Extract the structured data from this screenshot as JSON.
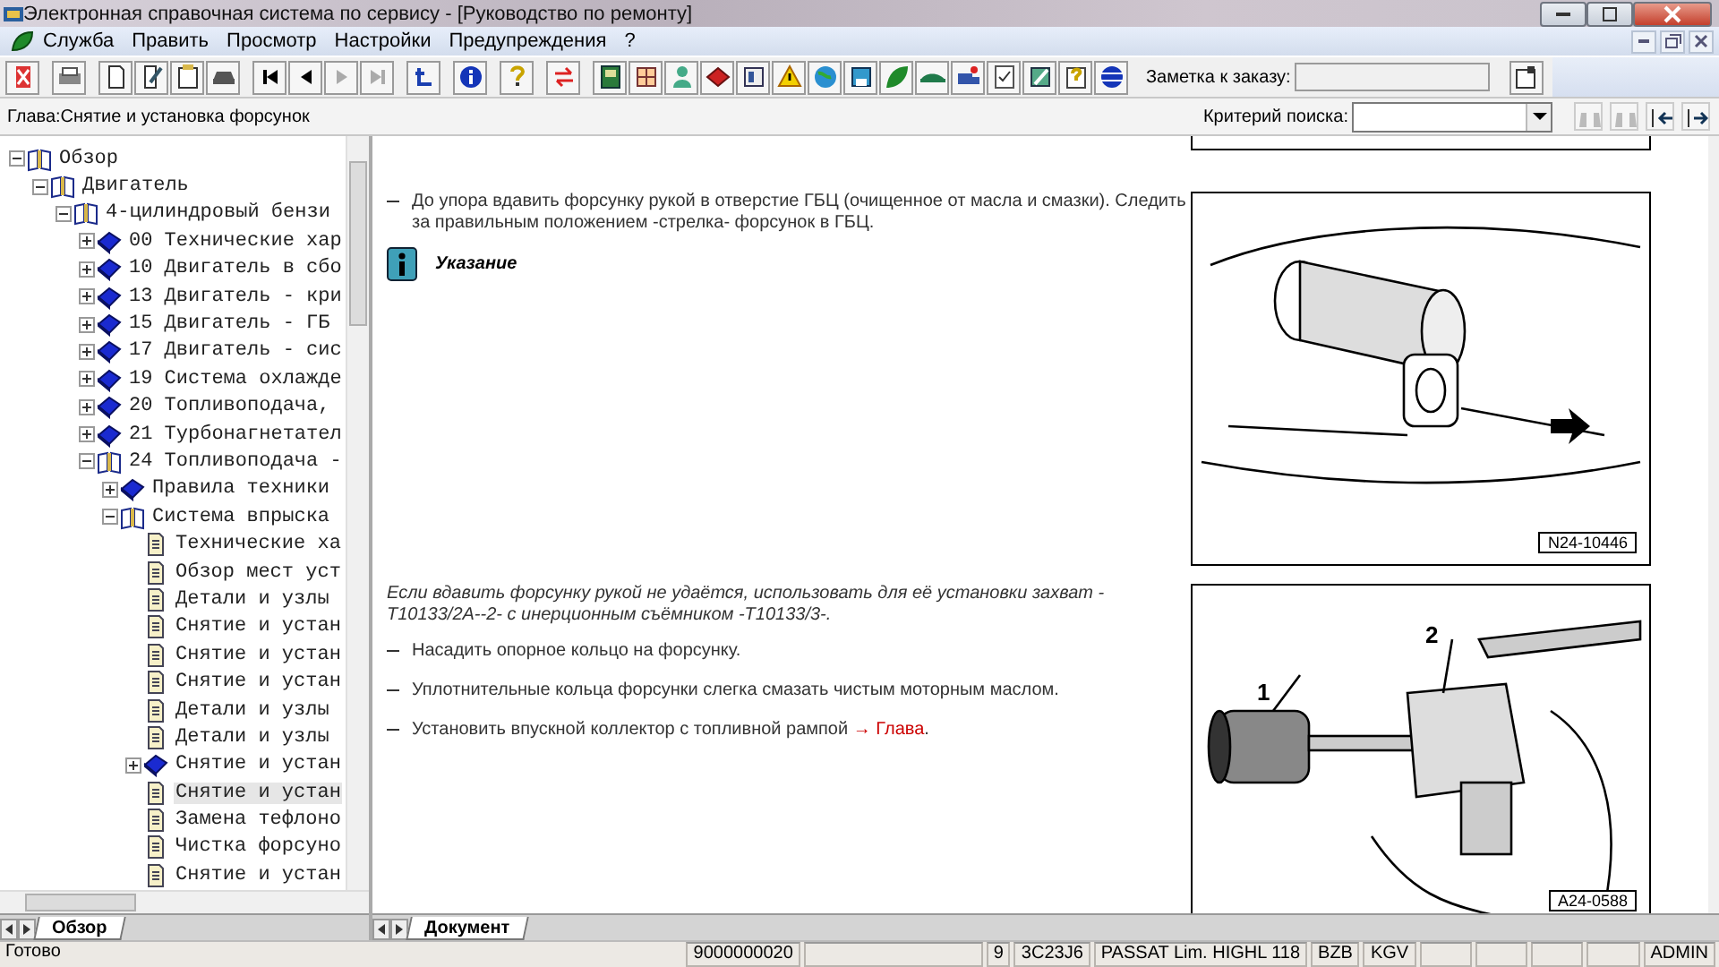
{
  "window": {
    "title": "Электронная справочная система по сервису - [Руководство по ремонту]"
  },
  "menu": [
    "Служба",
    "Править",
    "Просмотр",
    "Настройки",
    "Предупреждения",
    "?"
  ],
  "toolbar": {
    "note_label": "Заметка к заказу:"
  },
  "chapter_bar": {
    "chapter": "Глава:Снятие и установка форсунок",
    "search_label": "Критерий поиска:"
  },
  "tree": [
    {
      "kind": "chapter",
      "label": "Обзор",
      "expanded": true,
      "selected": false,
      "children": [
        {
          "kind": "chapter",
          "label": "Двигатель",
          "expanded": true,
          "selected": false,
          "children": [
            {
              "kind": "chapter",
              "label": "4-цилиндровый бензи",
              "expanded": true,
              "selected": false,
              "children": [
                {
                  "kind": "chapter",
                  "label": "00 Технические хар",
                  "expanded": false,
                  "selected": false
                },
                {
                  "kind": "chapter",
                  "label": "10 Двигатель в сбо",
                  "expanded": false,
                  "selected": false
                },
                {
                  "kind": "chapter",
                  "label": "13 Двигатель - кри",
                  "expanded": false,
                  "selected": false
                },
                {
                  "kind": "chapter",
                  "label": "15 Двигатель - ГБ",
                  "expanded": false,
                  "selected": false
                },
                {
                  "kind": "chapter",
                  "label": "17 Двигатель - сис",
                  "expanded": false,
                  "selected": false
                },
                {
                  "kind": "chapter",
                  "label": "19 Система охлажде",
                  "expanded": false,
                  "selected": false
                },
                {
                  "kind": "chapter",
                  "label": "20 Топливоподача,",
                  "expanded": false,
                  "selected": false
                },
                {
                  "kind": "chapter",
                  "label": "21 Турбонагнетател",
                  "expanded": false,
                  "selected": false
                },
                {
                  "kind": "chapter",
                  "label": "24 Топливоподача -",
                  "expanded": true,
                  "selected": false,
                  "children": [
                    {
                      "kind": "chapter",
                      "label": "Правила техники",
                      "expanded": false,
                      "selected": false
                    },
                    {
                      "kind": "chapter",
                      "label": "Система впрыска",
                      "expanded": true,
                      "selected": false,
                      "children": [
                        {
                          "kind": "page",
                          "label": "Технические ха",
                          "selected": false
                        },
                        {
                          "kind": "page",
                          "label": "Обзор мест уст",
                          "selected": false
                        },
                        {
                          "kind": "page",
                          "label": "Детали и узлы",
                          "selected": false
                        },
                        {
                          "kind": "page",
                          "label": "Снятие и устан",
                          "selected": false
                        },
                        {
                          "kind": "page",
                          "label": "Снятие и устан",
                          "selected": false
                        },
                        {
                          "kind": "page",
                          "label": "Снятие и устан",
                          "selected": false
                        },
                        {
                          "kind": "page",
                          "label": "Детали и узлы",
                          "selected": false
                        },
                        {
                          "kind": "page",
                          "label": "Детали и узлы",
                          "selected": false
                        },
                        {
                          "kind": "chapter",
                          "label": "Снятие и устан",
                          "expanded": false,
                          "selected": false
                        },
                        {
                          "kind": "page",
                          "label": "Снятие и устан",
                          "selected": true
                        },
                        {
                          "kind": "page",
                          "label": "Замена тефлоно",
                          "selected": false
                        },
                        {
                          "kind": "page",
                          "label": "Чистка форсуно",
                          "selected": false
                        },
                        {
                          "kind": "page",
                          "label": "Снятие и устан",
                          "selected": false
                        }
                      ]
                    }
                  ]
                }
              ]
            }
          ]
        }
      ]
    }
  ],
  "left_tabs": [
    {
      "label": "Обзор",
      "selected": true
    }
  ],
  "document": {
    "sections": [
      {
        "paragraphs": [
          {
            "kind": "step",
            "text": "До упора вдавить форсунку рукой в отверстие ГБЦ (очищенное от масла и смазки). Следить за правильным положением -стрелка- форсунок в ГБЦ."
          },
          {
            "kind": "note",
            "text": "Указание"
          }
        ],
        "figure": {
          "label": "N24-10446"
        }
      },
      {
        "paragraphs": [
          {
            "kind": "remark",
            "text": "Если вдавить форсунку рукой не удаётся, использовать для её установки захват -T10133/2A--2- с инерционным съёмником -T10133/3-."
          },
          {
            "kind": "step",
            "text": "Насадить опорное кольцо на форсунку."
          },
          {
            "kind": "step",
            "text": "Уплотнительные кольца форсунки слегка смазать чистым моторным маслом."
          },
          {
            "kind": "step",
            "text": "Установить впускной коллектор с топливной рампой ",
            "link": "→ Глава",
            "tail": "."
          }
        ],
        "figure": {
          "label": "A24-0588",
          "callouts": [
            "1",
            "2"
          ]
        }
      }
    ]
  },
  "document_tabs": [
    {
      "label": "Документ",
      "selected": true
    }
  ],
  "status_bar": {
    "message": "Готово",
    "fields": [
      "9000000020",
      "9",
      "3C23J6",
      "PASSAT Lim. HIGHL 118",
      "BZB",
      "KGV",
      "ADMIN"
    ]
  }
}
